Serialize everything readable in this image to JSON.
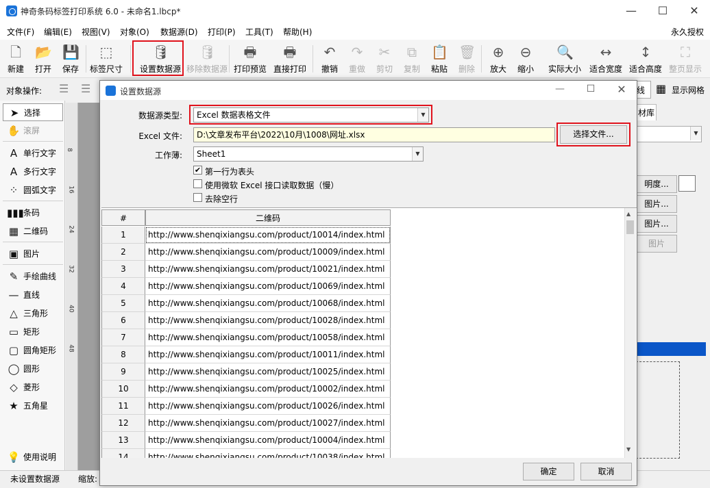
{
  "window": {
    "title": "神奇条码标签打印系统 6.0 - 未命名1.lbcp*",
    "license": "永久授权"
  },
  "menu": [
    "文件(F)",
    "编辑(E)",
    "视图(V)",
    "对象(O)",
    "数据源(D)",
    "打印(P)",
    "工具(T)",
    "帮助(H)"
  ],
  "toolbar": [
    {
      "label": "新建",
      "icon": "new-file-icon",
      "glyph": "🗋"
    },
    {
      "label": "打开",
      "icon": "open-icon",
      "glyph": "📂"
    },
    {
      "label": "保存",
      "icon": "save-icon",
      "glyph": "💾"
    },
    {
      "label": "标签尺寸",
      "icon": "label-size-icon",
      "glyph": "⬚"
    },
    {
      "label": "设置数据源",
      "icon": "database-icon",
      "glyph": "🛢"
    },
    {
      "label": "移除数据源",
      "icon": "remove-database-icon",
      "glyph": "🛢"
    },
    {
      "label": "打印预览",
      "icon": "print-preview-icon",
      "glyph": "🖶"
    },
    {
      "label": "直接打印",
      "icon": "printer-icon",
      "glyph": "🖶"
    },
    {
      "label": "撤销",
      "icon": "undo-icon",
      "glyph": "↶"
    },
    {
      "label": "重做",
      "icon": "redo-icon",
      "glyph": "↷"
    },
    {
      "label": "剪切",
      "icon": "cut-icon",
      "glyph": "✂"
    },
    {
      "label": "复制",
      "icon": "copy-icon",
      "glyph": "⧉"
    },
    {
      "label": "粘贴",
      "icon": "paste-icon",
      "glyph": "📋"
    },
    {
      "label": "删除",
      "icon": "delete-icon",
      "glyph": "🗑"
    },
    {
      "label": "放大",
      "icon": "zoom-in-icon",
      "glyph": "⊕"
    },
    {
      "label": "缩小",
      "icon": "zoom-out-icon",
      "glyph": "⊖"
    },
    {
      "label": "实际大小",
      "icon": "actual-size-icon",
      "glyph": "🔍"
    },
    {
      "label": "适合宽度",
      "icon": "fit-width-icon",
      "glyph": "↔"
    },
    {
      "label": "适合高度",
      "icon": "fit-height-icon",
      "glyph": "↕"
    },
    {
      "label": "整页显示",
      "icon": "full-page-icon",
      "glyph": "⛶"
    }
  ],
  "objbar": {
    "label": "对象操作:",
    "show_grid": "显示网格",
    "partial_line": "线"
  },
  "sidebar": [
    {
      "label": "选择",
      "icon": "pointer-icon",
      "glyph": "➤"
    },
    {
      "label": "滚屏",
      "icon": "hand-icon",
      "glyph": "✋"
    },
    {
      "label": "单行文字",
      "icon": "single-text-icon",
      "glyph": "A"
    },
    {
      "label": "多行文字",
      "icon": "multi-text-icon",
      "glyph": "A"
    },
    {
      "label": "圆弧文字",
      "icon": "arc-text-icon",
      "glyph": "⁘"
    },
    {
      "label": "条码",
      "icon": "barcode-icon",
      "glyph": "▮▮▮"
    },
    {
      "label": "二维码",
      "icon": "qrcode-icon",
      "glyph": "▦"
    },
    {
      "label": "图片",
      "icon": "image-icon",
      "glyph": "▣"
    },
    {
      "label": "手绘曲线",
      "icon": "pen-icon",
      "glyph": "✎"
    },
    {
      "label": "直线",
      "icon": "line-icon",
      "glyph": "—"
    },
    {
      "label": "三角形",
      "icon": "triangle-icon",
      "glyph": "△"
    },
    {
      "label": "矩形",
      "icon": "rectangle-icon",
      "glyph": "▭"
    },
    {
      "label": "圆角矩形",
      "icon": "rounded-rect-icon",
      "glyph": "▢"
    },
    {
      "label": "圆形",
      "icon": "circle-icon",
      "glyph": "◯"
    },
    {
      "label": "菱形",
      "icon": "diamond-icon",
      "glyph": "◇"
    },
    {
      "label": "五角星",
      "icon": "star-icon",
      "glyph": "★"
    },
    {
      "label": "使用说明",
      "icon": "lightbulb-icon",
      "glyph": "💡"
    }
  ],
  "ruler_marks": [
    "8",
    "16",
    "24",
    "32",
    "40",
    "48"
  ],
  "right_panel": {
    "tab": "材库",
    "opacity_btn": "明度...",
    "img_btn1": "图片...",
    "img_btn2": "图片...",
    "img_btn3": "图片"
  },
  "status": {
    "left": "未设置数据源",
    "zoom_label": "缩放:"
  },
  "dialog": {
    "title": "设置数据源",
    "source_type_label": "数据源类型:",
    "source_type_value": "Excel 数据表格文件",
    "excel_file_label": "Excel 文件:",
    "excel_file_value": "D:\\文章发布平台\\2022\\10月\\1008\\网址.xlsx",
    "choose_file": "选择文件...",
    "workbook_label": "工作薄:",
    "workbook_value": "Sheet1",
    "opt_header": "第一行为表头",
    "opt_header_checked": true,
    "opt_msexcel": "使用微软 Excel 接口读取数据（慢）",
    "opt_msexcel_checked": false,
    "opt_trim": "去除空行",
    "opt_trim_checked": false,
    "grid_headers": [
      "#",
      "二维码"
    ],
    "rows": [
      "http://www.shenqixiangsu.com/product/10014/index.html",
      "http://www.shenqixiangsu.com/product/10009/index.html",
      "http://www.shenqixiangsu.com/product/10021/index.html",
      "http://www.shenqixiangsu.com/product/10069/index.html",
      "http://www.shenqixiangsu.com/product/10068/index.html",
      "http://www.shenqixiangsu.com/product/10028/index.html",
      "http://www.shenqixiangsu.com/product/10058/index.html",
      "http://www.shenqixiangsu.com/product/10011/index.html",
      "http://www.shenqixiangsu.com/product/10025/index.html",
      "http://www.shenqixiangsu.com/product/10002/index.html",
      "http://www.shenqixiangsu.com/product/10026/index.html",
      "http://www.shenqixiangsu.com/product/10027/index.html",
      "http://www.shenqixiangsu.com/product/10004/index.html",
      "http://www.shenqixiangsu.com/product/10038/index.html"
    ],
    "ok": "确定",
    "cancel": "取消"
  },
  "colors": {
    "accent": "#1a73d9",
    "highlight_border": "#e0121c",
    "selection_bar": "#0a56c8"
  }
}
